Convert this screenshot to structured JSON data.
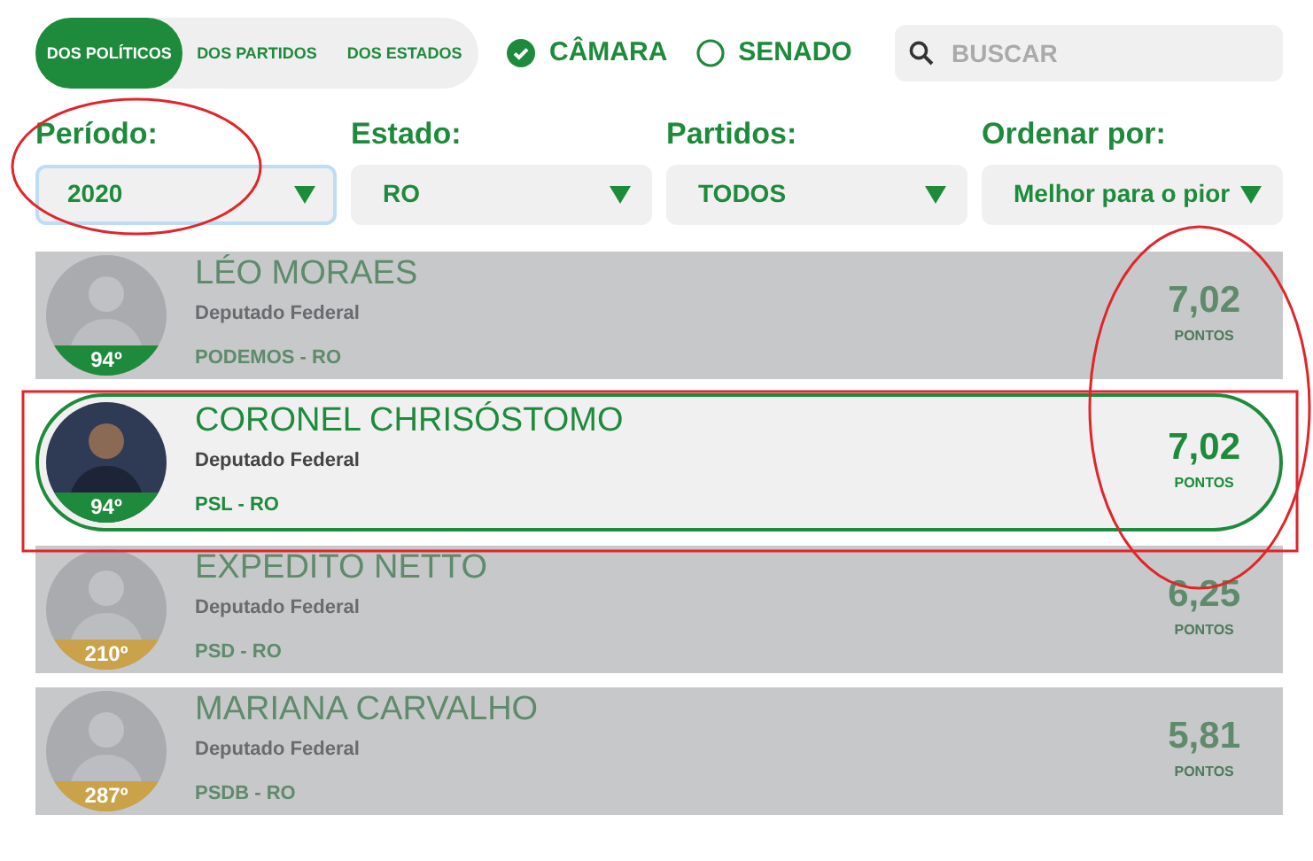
{
  "view_tabs": [
    {
      "label": "DOS POLÍTICOS",
      "selected": true
    },
    {
      "label": "DOS PARTIDOS",
      "selected": false
    },
    {
      "label": "DOS ESTADOS",
      "selected": false
    }
  ],
  "houses": [
    {
      "label": "CÂMARA",
      "selected": true
    },
    {
      "label": "SENADO",
      "selected": false
    }
  ],
  "search": {
    "placeholder": "BUSCAR"
  },
  "filters": [
    {
      "label": "Período:",
      "value": "2020",
      "focused": true
    },
    {
      "label": "Estado:",
      "value": "RO",
      "focused": false
    },
    {
      "label": "Partidos:",
      "value": "TODOS",
      "focused": false
    },
    {
      "label": "Ordenar por:",
      "value": "Melhor para o pior",
      "focused": false
    }
  ],
  "politicians": [
    {
      "name": "LÉO MORAES",
      "role": "Deputado Federal",
      "party": "PODEMOS - RO",
      "rank": "94º",
      "score": "7,02",
      "score_unit": "PONTOS",
      "dimmed": true,
      "highlighted": false,
      "color": "#1e8a3c"
    },
    {
      "name": "CORONEL CHRISÓSTOMO",
      "role": "Deputado Federal",
      "party": "PSL - RO",
      "rank": "94º",
      "score": "7,02",
      "score_unit": "PONTOS",
      "dimmed": false,
      "highlighted": true,
      "color": "#1e8a3c"
    },
    {
      "name": "EXPEDITO NETTO",
      "role": "Deputado Federal",
      "party": "PSD - RO",
      "rank": "210º",
      "score": "6,25",
      "score_unit": "PONTOS",
      "dimmed": true,
      "highlighted": false,
      "color": "#c9a24a"
    },
    {
      "name": "MARIANA CARVALHO",
      "role": "Deputado Federal",
      "party": "PSDB - RO",
      "rank": "287º",
      "score": "5,81",
      "score_unit": "PONTOS",
      "dimmed": true,
      "highlighted": false,
      "color": "#c9a24a"
    }
  ]
}
